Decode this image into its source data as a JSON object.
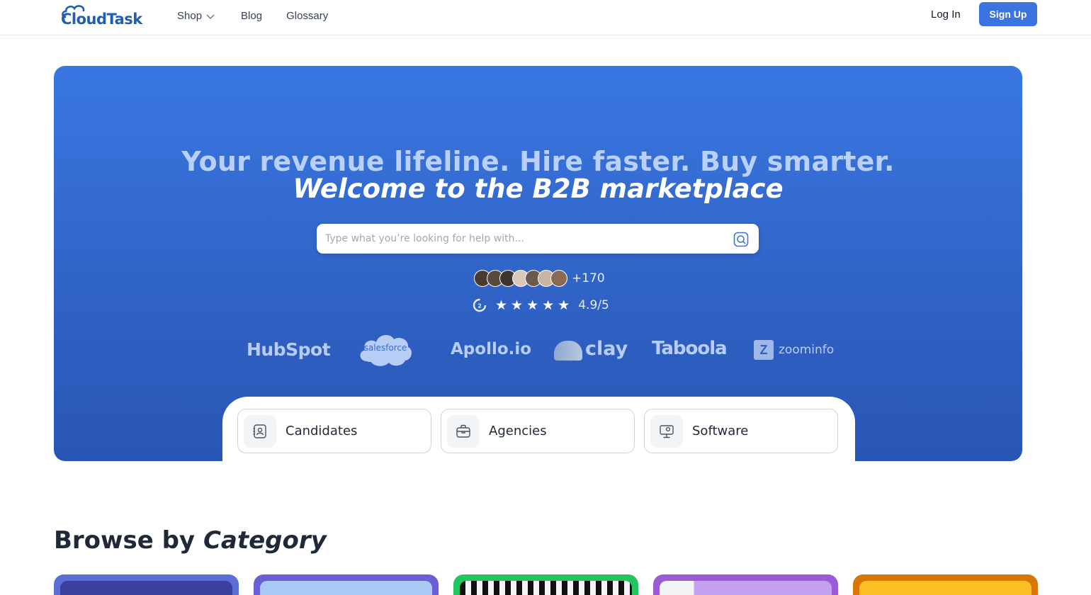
{
  "nav": {
    "logo": "CloudTask",
    "links": [
      "Shop",
      "Blog",
      "Glossary"
    ],
    "login": "Log In",
    "signup": "Sign Up"
  },
  "hero": {
    "headline": "Your revenue lifeline. Hire faster. Buy smarter.",
    "subheadline": "Welcome to the B2B marketplace",
    "search_placeholder": "Type what you’re looking for help with...",
    "avatar_count": "+170",
    "rating": "4.9/5",
    "stars": 5,
    "brands": [
      "HubSpot",
      "salesforce",
      "Apollo.io",
      "clay",
      "Taboola",
      "zoominfo"
    ],
    "categories": [
      "Candidates",
      "Agencies",
      "Software"
    ]
  },
  "browse": {
    "prefix": "Browse by",
    "emphasis": "Category"
  },
  "colors": {
    "brand": "#1e5fb4",
    "accent": "#3b74e0",
    "hero_top": "#3a77e2",
    "hero_bottom": "#2956b5"
  },
  "icons": [
    "chevron-down-icon",
    "search-icon",
    "g2-icon",
    "star-icon",
    "candidates-icon",
    "agencies-icon",
    "software-icon"
  ]
}
